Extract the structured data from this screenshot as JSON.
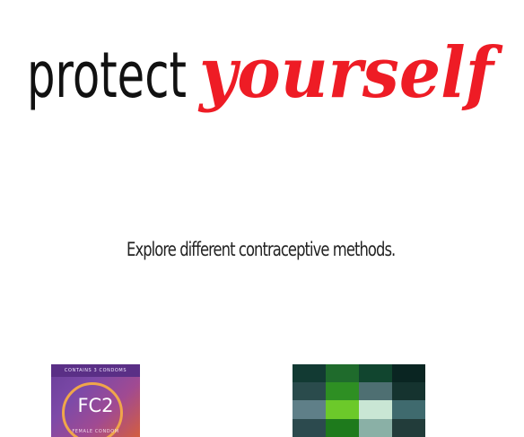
{
  "header": {
    "title_prefix": "protect",
    "title_emphasis": "yourself"
  },
  "intro": {
    "tagline": "Explore different contraceptive methods."
  },
  "methods": [
    {
      "id": "female-condom",
      "package_top_text": "CONTAINS 3 CONDOMS",
      "logo_text": "FC2",
      "package_bottom_text": "FEMALE CONDOM"
    },
    {
      "id": "method-2"
    }
  ],
  "colors": {
    "accent": "#ee1c25",
    "text": "#111111"
  }
}
